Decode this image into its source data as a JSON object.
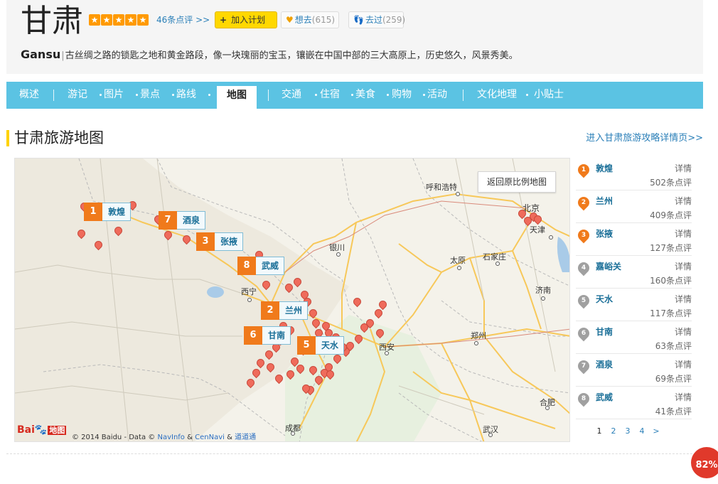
{
  "header": {
    "title": "甘肃",
    "rating_stars": 5,
    "reviews": "46条点评 >>",
    "plan_button": "加入计划",
    "want_label": "想去",
    "want_count": "(615)",
    "been_label": "去过",
    "been_count": "(259)",
    "desc_en": "Gansu",
    "desc_text": "古丝绸之路的锁匙之地和黄金路段，像一块瑰丽的宝玉，镶嵌在中国中部的三大高原上，历史悠久，风景秀美。"
  },
  "nav": {
    "items": [
      "概述",
      "游记",
      "图片",
      "景点",
      "路线",
      "地图",
      "交通",
      "住宿",
      "美食",
      "购物",
      "活动",
      "文化地理",
      "小贴士"
    ],
    "active": "地图"
  },
  "section": {
    "title": "甘肃旅游地图",
    "link": "进入甘肃旅游攻略详情页>>"
  },
  "map": {
    "reset_button": "返回原比例地图",
    "copyright": "© 2014 Baidu - Data ©",
    "copyright_links": [
      "NavInfo",
      "&",
      "CenNavi",
      "&",
      "道道通"
    ],
    "logo_text": "Bai",
    "logo_paw": "🐾",
    "logo_di": "地图",
    "cities": [
      "呼和浩特",
      "北京",
      "天津",
      "银川",
      "太原",
      "石家庄",
      "济南",
      "西宁",
      "郑州",
      "西安",
      "合肥",
      "成都",
      "武汉"
    ],
    "markers": [
      {
        "num": "1",
        "name": "敦煌"
      },
      {
        "num": "7",
        "name": "酒泉"
      },
      {
        "num": "3",
        "name": "张掖"
      },
      {
        "num": "8",
        "name": "武威"
      },
      {
        "num": "2",
        "name": "兰州"
      },
      {
        "num": "6",
        "name": "甘南"
      },
      {
        "num": "5",
        "name": "天水"
      }
    ]
  },
  "side_list": {
    "items": [
      {
        "num": "1",
        "name": "敦煌",
        "detail": "详情",
        "count": "502条点评",
        "color": "#f07a1b"
      },
      {
        "num": "2",
        "name": "兰州",
        "detail": "详情",
        "count": "409条点评",
        "color": "#f07a1b"
      },
      {
        "num": "3",
        "name": "张掖",
        "detail": "详情",
        "count": "127条点评",
        "color": "#f07a1b"
      },
      {
        "num": "4",
        "name": "嘉峪关",
        "detail": "详情",
        "count": "160条点评",
        "color": "#a0a0a0"
      },
      {
        "num": "5",
        "name": "天水",
        "detail": "详情",
        "count": "117条点评",
        "color": "#a0a0a0"
      },
      {
        "num": "6",
        "name": "甘南",
        "detail": "详情",
        "count": "63条点评",
        "color": "#a0a0a0"
      },
      {
        "num": "7",
        "name": "酒泉",
        "detail": "详情",
        "count": "69条点评",
        "color": "#a0a0a0"
      },
      {
        "num": "8",
        "name": "武威",
        "detail": "详情",
        "count": "41条点评",
        "color": "#a0a0a0"
      }
    ],
    "pages": [
      "1",
      "2",
      "3",
      "4",
      ">"
    ]
  },
  "badge": "82%",
  "colors": {
    "nav_bg": "#5bc3e3",
    "accent_yellow": "#ffd200",
    "marker_orange": "#f07a1b",
    "link_blue": "#2a7fb8"
  }
}
